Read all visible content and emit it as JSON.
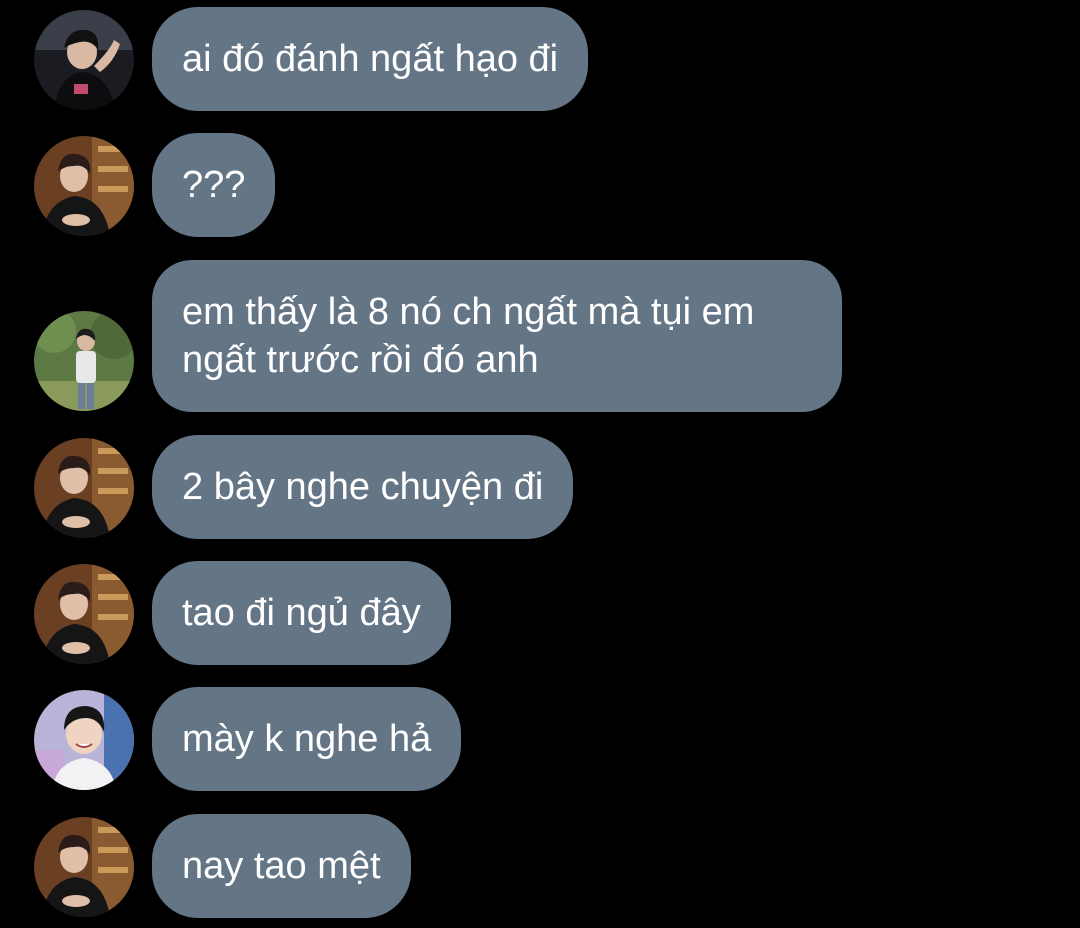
{
  "messages": [
    {
      "avatar": "user-avatar-a",
      "text": "ai đó đánh ngất hạo đi"
    },
    {
      "avatar": "user-avatar-b",
      "text": "???"
    },
    {
      "avatar": "user-avatar-c",
      "text": "em thấy là 8 nó ch ngất mà tụi em ngất trước rồi đó anh"
    },
    {
      "avatar": "user-avatar-b",
      "text": "2 bây nghe chuyện đi"
    },
    {
      "avatar": "user-avatar-b",
      "text": "tao đi ngủ đây"
    },
    {
      "avatar": "user-avatar-d",
      "text": "mày k nghe hả"
    },
    {
      "avatar": "user-avatar-b",
      "text": "nay tao mệt"
    }
  ],
  "colors": {
    "background": "#000000",
    "bubble": "#647586",
    "text": "#ffffff"
  }
}
